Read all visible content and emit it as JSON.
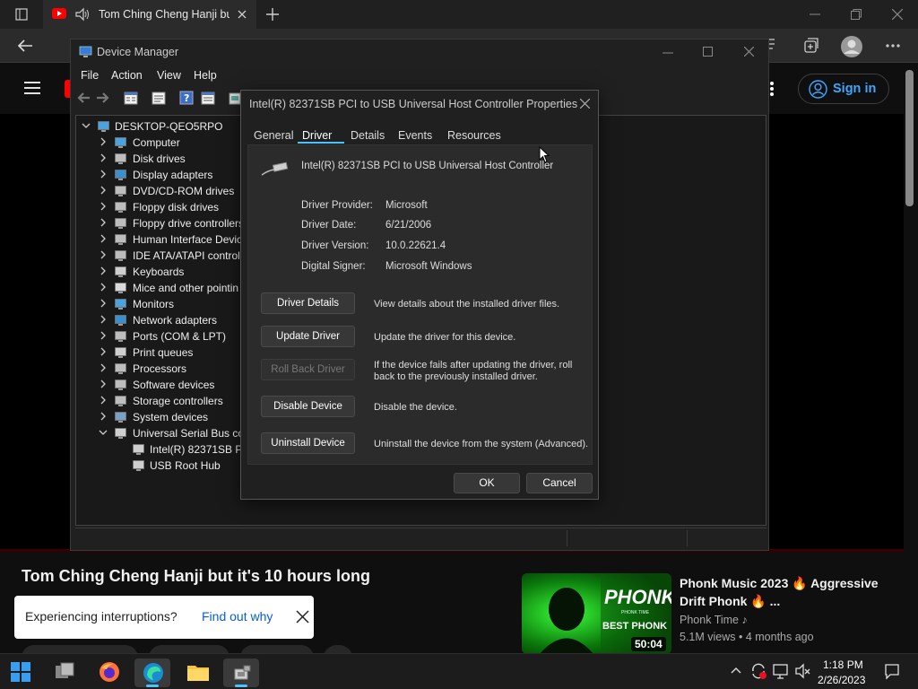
{
  "browser": {
    "tab_title": "Tom Ching Cheng Hanji but it's 10 hours long",
    "signin_label": "Sign in"
  },
  "youtube": {
    "video_title": "Tom Ching Cheng Hanji but it's 10 hours long",
    "interrupt_question": "Experiencing interruptions?",
    "interrupt_link": "Find out why",
    "recommendation": {
      "title": "Phonk Music 2023 🔥 Aggressive Drift Phonk 🔥 ...",
      "channel": "Phonk Time ♪",
      "stats": "5.1M views • 4 months ago",
      "duration": "50:04",
      "thumb_text_top": "PHONK",
      "thumb_text_sub": "PHONK TIME",
      "thumb_text_bottom": "BEST PHONK"
    }
  },
  "device_manager": {
    "title": "Device Manager",
    "menu": [
      "File",
      "Action",
      "View",
      "Help"
    ],
    "root": "DESKTOP-QEO5RPO",
    "categories": [
      {
        "label": "Computer",
        "icon": "computer-icon"
      },
      {
        "label": "Disk drives",
        "icon": "disk-drive-icon"
      },
      {
        "label": "Display adapters",
        "icon": "display-adapter-icon"
      },
      {
        "label": "DVD/CD-ROM drives",
        "icon": "dvd-drive-icon"
      },
      {
        "label": "Floppy disk drives",
        "icon": "floppy-disk-icon"
      },
      {
        "label": "Floppy drive controllers",
        "icon": "floppy-controller-icon"
      },
      {
        "label": "Human Interface Devic",
        "icon": "hid-icon"
      },
      {
        "label": "IDE ATA/ATAPI controlle",
        "icon": "ide-controller-icon"
      },
      {
        "label": "Keyboards",
        "icon": "keyboard-icon"
      },
      {
        "label": "Mice and other pointin",
        "icon": "mouse-icon"
      },
      {
        "label": "Monitors",
        "icon": "monitor-icon"
      },
      {
        "label": "Network adapters",
        "icon": "network-adapter-icon"
      },
      {
        "label": "Ports (COM & LPT)",
        "icon": "port-icon"
      },
      {
        "label": "Print queues",
        "icon": "printer-icon"
      },
      {
        "label": "Processors",
        "icon": "processor-icon"
      },
      {
        "label": "Software devices",
        "icon": "software-device-icon"
      },
      {
        "label": "Storage controllers",
        "icon": "storage-controller-icon"
      },
      {
        "label": "System devices",
        "icon": "system-device-icon"
      },
      {
        "label": "Universal Serial Bus cor",
        "icon": "usb-icon",
        "expanded": true
      }
    ],
    "usb_children": [
      "Intel(R) 82371SB PC",
      "USB Root Hub"
    ]
  },
  "dialog": {
    "title": "Intel(R) 82371SB PCI to USB Universal Host Controller Properties",
    "tabs": [
      "General",
      "Driver",
      "Details",
      "Events",
      "Resources"
    ],
    "active_tab": "Driver",
    "device_name": "Intel(R) 82371SB PCI to USB Universal Host Controller",
    "fields": [
      {
        "label": "Driver Provider:",
        "value": "Microsoft"
      },
      {
        "label": "Driver Date:",
        "value": "6/21/2006"
      },
      {
        "label": "Driver Version:",
        "value": "10.0.22621.4"
      },
      {
        "label": "Digital Signer:",
        "value": "Microsoft Windows"
      }
    ],
    "actions": [
      {
        "button": "Driver Details",
        "desc": "View details about the installed driver files.",
        "enabled": true
      },
      {
        "button": "Update Driver",
        "desc": "Update the driver for this device.",
        "enabled": true
      },
      {
        "button": "Roll Back Driver",
        "desc": "If the device fails after updating the driver, roll back to the previously installed driver.",
        "enabled": false
      },
      {
        "button": "Disable Device",
        "desc": "Disable the device.",
        "enabled": true
      },
      {
        "button": "Uninstall Device",
        "desc": "Uninstall the device from the system (Advanced).",
        "enabled": true
      }
    ],
    "ok_label": "OK",
    "cancel_label": "Cancel"
  },
  "taskbar": {
    "time": "1:18 PM",
    "date": "2/26/2023"
  },
  "colors": {
    "accent": "#4cc2ff",
    "youtube_red": "#ff0000",
    "link_blue": "#3ea6ff"
  }
}
